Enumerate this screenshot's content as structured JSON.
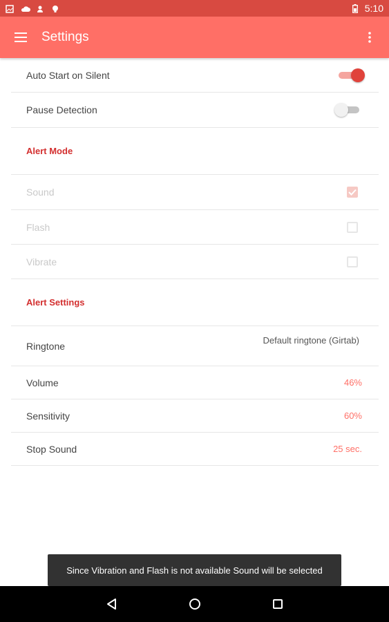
{
  "status_bar": {
    "time": "5:10",
    "notification_icons": [
      "image-icon",
      "cloud-icon",
      "person-icon",
      "lightbulb-icon"
    ],
    "battery_icon": "battery-icon"
  },
  "app_bar": {
    "title": "Settings",
    "background": "#ff6f66",
    "menu_icon": "hamburger-menu-icon",
    "overflow_icon": "more-vert-icon"
  },
  "settings": {
    "auto_start": {
      "label": "Auto Start on Silent",
      "enabled": true
    },
    "pause_detection": {
      "label": "Pause Detection",
      "enabled": false
    },
    "alert_mode": {
      "header": "Alert Mode",
      "sound": {
        "label": "Sound",
        "checked": true
      },
      "flash": {
        "label": "Flash",
        "checked": false
      },
      "vibrate": {
        "label": "Vibrate",
        "checked": false
      }
    },
    "alert_settings": {
      "header": "Alert Settings",
      "ringtone": {
        "label": "Ringtone",
        "value": "Default ringtone (Girtab)"
      },
      "volume": {
        "label": "Volume",
        "value": "46%"
      },
      "sensitivity": {
        "label": "Sensitivity",
        "value": "60%"
      },
      "stop_sound": {
        "label": "Stop Sound",
        "value": "25 sec."
      }
    }
  },
  "snackbar": {
    "message": "Since Vibration and Flash is not available Sound will be selected"
  },
  "nav_bar": {
    "buttons": [
      "back-icon",
      "home-icon",
      "recents-icon"
    ]
  },
  "colors": {
    "accent": "#ff6f66",
    "status_bar": "#d84a41",
    "section_header": "#d32f2f"
  }
}
